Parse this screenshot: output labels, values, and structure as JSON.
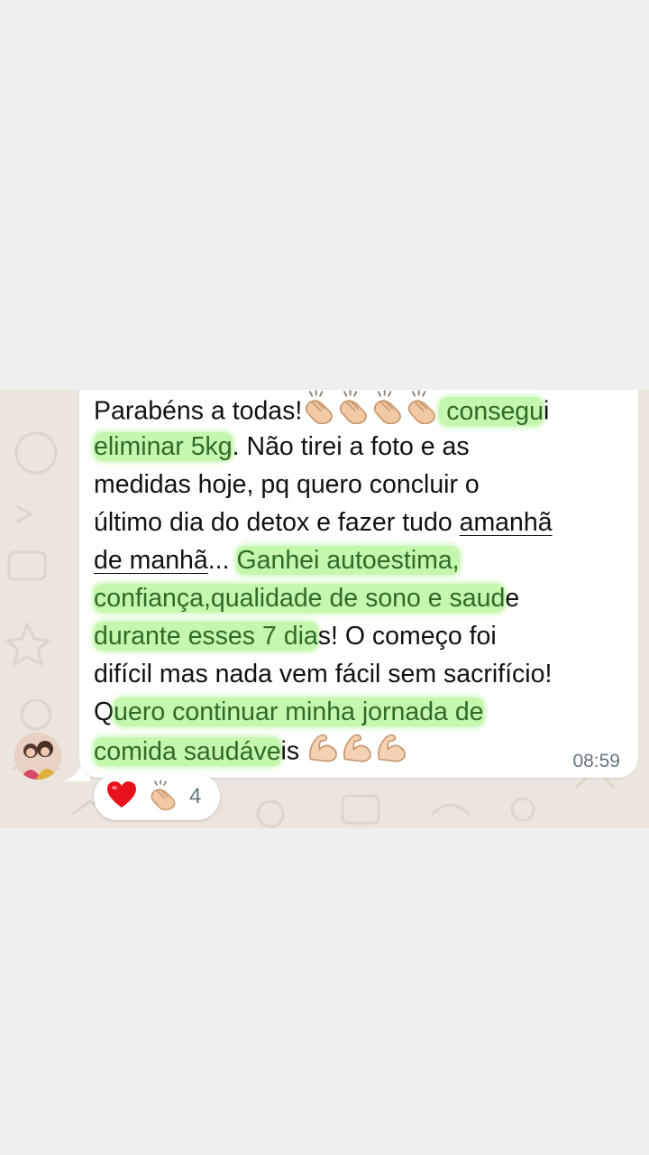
{
  "message": {
    "lines": [
      [
        {
          "t": "Parabéns a todas!"
        },
        {
          "emoji": "clap"
        },
        {
          "emoji": "clap"
        },
        {
          "emoji": "clap"
        },
        {
          "emoji": "clap"
        },
        {
          "t": " consegu",
          "hl": true
        },
        {
          "t": "i"
        }
      ],
      [
        {
          "t": "eliminar 5kg",
          "hl": true
        },
        {
          "t": ". Não tirei a foto e as"
        }
      ],
      [
        {
          "t": "medidas hoje, pq quero concluir o"
        }
      ],
      [
        {
          "t": "último dia do detox e fazer tudo "
        },
        {
          "t": "amanhã",
          "ul": true
        }
      ],
      [
        {
          "t": "de manhã",
          "ul": true
        },
        {
          "t": "... "
        },
        {
          "t": "Ganhei autoestima,",
          "hl": true
        }
      ],
      [
        {
          "t": "confiança,qualidade de sono e saud",
          "hl": true
        },
        {
          "t": "e"
        }
      ],
      [
        {
          "t": "durante esses 7 dia",
          "hl": true
        },
        {
          "t": "s! O começo foi"
        }
      ],
      [
        {
          "t": "difícil mas nada vem fácil sem sacrifício!"
        }
      ],
      [
        {
          "t": "Q"
        },
        {
          "t": "uero continuar minha jornada de",
          "hl": true
        }
      ],
      [
        {
          "t": "comida saudáve",
          "hl": true
        },
        {
          "t": "is "
        },
        {
          "emoji": "muscle"
        },
        {
          "emoji": "muscle"
        },
        {
          "emoji": "muscle"
        }
      ]
    ],
    "time": "08:59"
  },
  "reactions": {
    "icons": [
      "heart-icon",
      "clap-icon"
    ],
    "count": "4"
  },
  "colors": {
    "bubble": "#ffffff",
    "highlight": "#96f06e",
    "wallpaper": "#ece5dd",
    "timestamp": "#667781"
  }
}
